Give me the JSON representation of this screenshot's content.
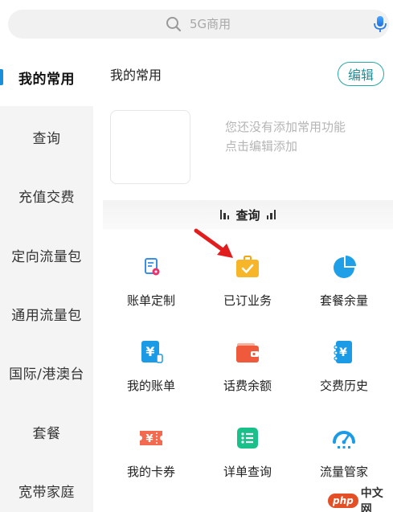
{
  "search": {
    "placeholder": "5G商用",
    "icon": "search-icon",
    "voice_icon": "microphone-icon"
  },
  "sidebar": {
    "items": [
      {
        "label": "我的常用",
        "active": true
      },
      {
        "label": "查询"
      },
      {
        "label": "充值交费"
      },
      {
        "label": "定向流量包"
      },
      {
        "label": "通用流量包"
      },
      {
        "label": "国际/港澳台"
      },
      {
        "label": "套餐"
      },
      {
        "label": "宽带家庭"
      }
    ],
    "accent": "#1a8fd9"
  },
  "favorites": {
    "title": "我的常用",
    "edit_label": "编辑",
    "empty_line1": "您还没有添加常用功能",
    "empty_line2": "点击编辑添加"
  },
  "query_section": {
    "title": "查询",
    "items": [
      {
        "label": "账单定制",
        "icon": "bill-custom-icon"
      },
      {
        "label": "已订业务",
        "icon": "subscribed-briefcase-icon"
      },
      {
        "label": "套餐余量",
        "icon": "pie-chart-icon"
      },
      {
        "label": "我的账单",
        "icon": "yuan-bill-icon"
      },
      {
        "label": "话费余额",
        "icon": "wallet-icon"
      },
      {
        "label": "交费历史",
        "icon": "payment-history-icon"
      },
      {
        "label": "我的卡券",
        "icon": "coupon-icon"
      },
      {
        "label": "详单查询",
        "icon": "detail-list-icon"
      },
      {
        "label": "流量管家",
        "icon": "speedometer-icon"
      }
    ]
  },
  "watermark": {
    "brand": "php",
    "text": "中文网"
  }
}
